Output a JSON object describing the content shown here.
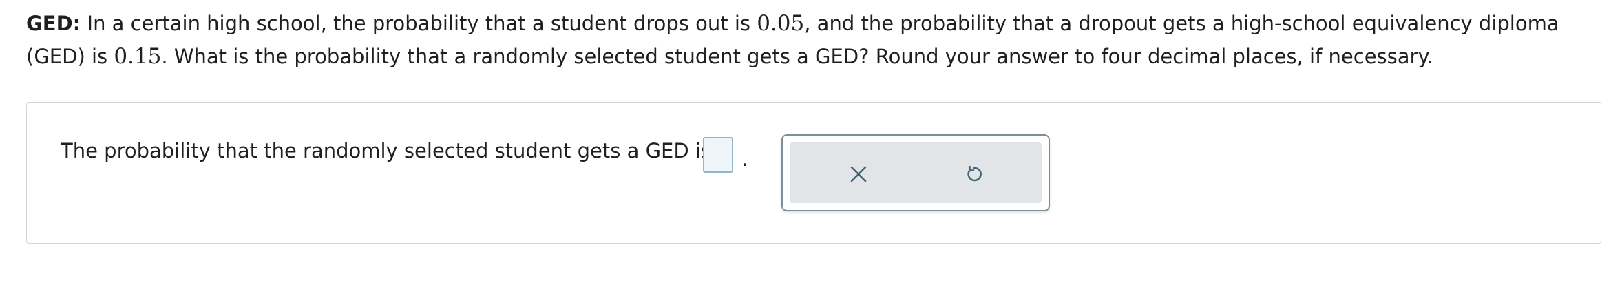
{
  "question": {
    "lead": "GED:",
    "text_1": " In a certain high school, the probability that a student drops out is ",
    "value_1": "0.05",
    "text_2": ", and the probability that a dropout gets a high-school equivalency diploma (GED) is ",
    "value_2": "0.15",
    "text_3": ". What is the probability that a randomly selected student gets a GED? Round your answer to four decimal places, if necessary."
  },
  "answer": {
    "prompt": "The probability that the randomly selected student gets a GED is",
    "input_value": "",
    "suffix": "."
  },
  "tools": {
    "clear_icon": "close-icon",
    "undo_icon": "undo-icon",
    "icon_color": "#3f6478"
  }
}
